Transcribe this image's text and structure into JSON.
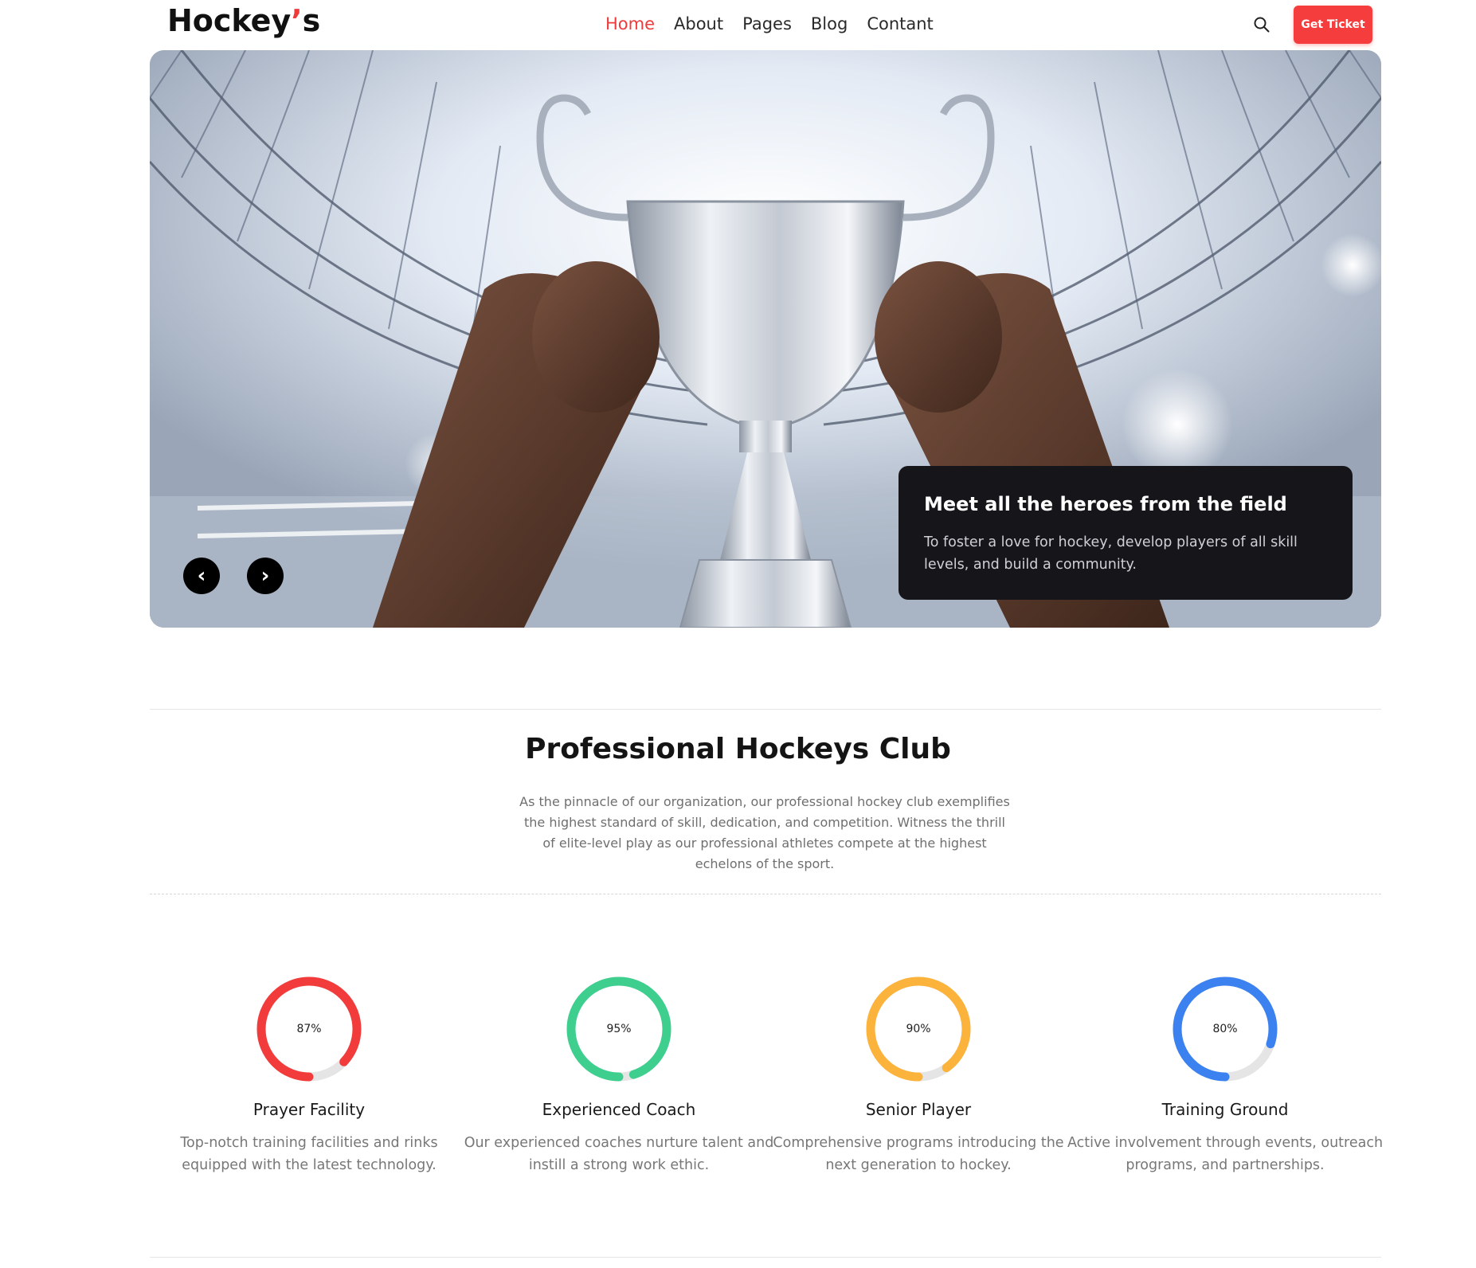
{
  "header": {
    "logo_main": "Hockey",
    "logo_apos": "’",
    "logo_end": "s",
    "nav": [
      "Home",
      "About",
      "Pages",
      "Blog",
      "Contant"
    ],
    "active_index": 0,
    "search_icon": "search-icon",
    "ticket_label": "Get Ticket"
  },
  "hero": {
    "prev_symbol": "‹",
    "next_symbol": "›",
    "caption_title": "Meet all the heroes from the field",
    "caption_text": "To foster a love for hockey, develop players of all skill levels, and build a community."
  },
  "intro": {
    "title": "Professional Hockeys Club",
    "description": "As the pinnacle of our organization, our professional hockey club exemplifies the highest standard of skill, dedication, and competition. Witness the thrill of elite-level play as our professional athletes compete at the highest echelons of the sport."
  },
  "stats": [
    {
      "percent": 87,
      "label": "87%",
      "color": "#f23c3c",
      "title": "Prayer Facility",
      "desc": "Top-notch training facilities and rinks equipped with the latest technology."
    },
    {
      "percent": 95,
      "label": "95%",
      "color": "#3ecf8e",
      "title": "Experienced Coach",
      "desc": "Our experienced coaches nurture talent and instill a strong work ethic."
    },
    {
      "percent": 90,
      "label": "90%",
      "color": "#fbb33c",
      "title": "Senior Player",
      "desc": "Comprehensive programs introducing the next generation to hockey."
    },
    {
      "percent": 80,
      "label": "80%",
      "color": "#3b82f0",
      "title": "Training Ground",
      "desc": "Active involvement through events, outreach programs, and partnerships."
    }
  ],
  "colors": {
    "accent": "#f53d3d",
    "track": "#e5e5e5"
  }
}
